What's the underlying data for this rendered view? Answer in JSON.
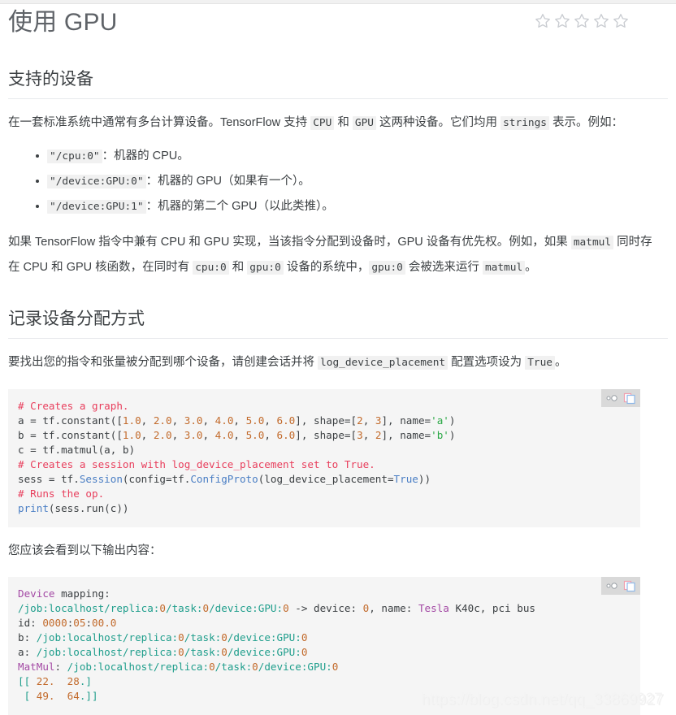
{
  "page": {
    "title": "使用 GPU",
    "watermark": "https://blog.csdn.net/qq_33869927",
    "watermark_shadow": "https://blog.csdn.net/qq_33869927"
  },
  "rating": {
    "name": "star-rating",
    "total": 5,
    "filled": 0
  },
  "sections": [
    {
      "heading": "支持的设备",
      "intro_a": "在一套标准系统中通常有多台计算设备。TensorFlow 支持 ",
      "intro_code1": "CPU",
      "intro_b": " 和 ",
      "intro_code2": "GPU",
      "intro_c": " 这两种设备。它们均用 ",
      "intro_code3": "strings",
      "intro_d": " 表示。例如：",
      "items": [
        {
          "code": "\"/cpu:0\"",
          "text": "：机器的 CPU。"
        },
        {
          "code": "\"/device:GPU:0\"",
          "text": "：机器的 GPU（如果有一个）。"
        },
        {
          "code": "\"/device:GPU:1\"",
          "text": "：机器的第二个 GPU（以此类推）。"
        }
      ],
      "para2_a": "如果 TensorFlow 指令中兼有 CPU 和 GPU 实现，当该指令分配到设备时，GPU 设备有优先权。例如，如果 ",
      "para2_code1": "matmul",
      "para2_b": " 同时存在 CPU 和 GPU 核函数，在同时有 ",
      "para2_code2": "cpu:0",
      "para2_c": " 和 ",
      "para2_code3": "gpu:0",
      "para2_d": " 设备的系统中，",
      "para2_code4": "gpu:0",
      "para2_e": " 会被选来运行 ",
      "para2_code5": "matmul",
      "para2_f": "。"
    },
    {
      "heading": "记录设备分配方式",
      "para_a": "要找出您的指令和张量被分配到哪个设备，请创建会话并将 ",
      "para_code1": "log_device_placement",
      "para_b": " 配置选项设为 ",
      "para_code2": "True",
      "para_c": "。",
      "output_label": "您应该会看到以下输出内容："
    }
  ],
  "code_toolbar": {
    "toggle_icon": "code-collapse-icon",
    "copy_icon": "copy-icon"
  },
  "code_block_python": {
    "lines": [
      [
        {
          "t": "# Creates a graph.",
          "c": "tok-com"
        }
      ],
      [
        {
          "t": "a = tf.constant([",
          "c": "tok-plain"
        },
        {
          "t": "1.0",
          "c": "tok-num"
        },
        {
          "t": ", ",
          "c": "tok-plain"
        },
        {
          "t": "2.0",
          "c": "tok-num"
        },
        {
          "t": ", ",
          "c": "tok-plain"
        },
        {
          "t": "3.0",
          "c": "tok-num"
        },
        {
          "t": ", ",
          "c": "tok-plain"
        },
        {
          "t": "4.0",
          "c": "tok-num"
        },
        {
          "t": ", ",
          "c": "tok-plain"
        },
        {
          "t": "5.0",
          "c": "tok-num"
        },
        {
          "t": ", ",
          "c": "tok-plain"
        },
        {
          "t": "6.0",
          "c": "tok-num"
        },
        {
          "t": "], shape=[",
          "c": "tok-plain"
        },
        {
          "t": "2",
          "c": "tok-num"
        },
        {
          "t": ", ",
          "c": "tok-plain"
        },
        {
          "t": "3",
          "c": "tok-num"
        },
        {
          "t": "], name=",
          "c": "tok-plain"
        },
        {
          "t": "'a'",
          "c": "tok-str"
        },
        {
          "t": ")",
          "c": "tok-plain"
        }
      ],
      [
        {
          "t": "b = tf.constant([",
          "c": "tok-plain"
        },
        {
          "t": "1.0",
          "c": "tok-num"
        },
        {
          "t": ", ",
          "c": "tok-plain"
        },
        {
          "t": "2.0",
          "c": "tok-num"
        },
        {
          "t": ", ",
          "c": "tok-plain"
        },
        {
          "t": "3.0",
          "c": "tok-num"
        },
        {
          "t": ", ",
          "c": "tok-plain"
        },
        {
          "t": "4.0",
          "c": "tok-num"
        },
        {
          "t": ", ",
          "c": "tok-plain"
        },
        {
          "t": "5.0",
          "c": "tok-num"
        },
        {
          "t": ", ",
          "c": "tok-plain"
        },
        {
          "t": "6.0",
          "c": "tok-num"
        },
        {
          "t": "], shape=[",
          "c": "tok-plain"
        },
        {
          "t": "3",
          "c": "tok-num"
        },
        {
          "t": ", ",
          "c": "tok-plain"
        },
        {
          "t": "2",
          "c": "tok-num"
        },
        {
          "t": "], name=",
          "c": "tok-plain"
        },
        {
          "t": "'b'",
          "c": "tok-str"
        },
        {
          "t": ")",
          "c": "tok-plain"
        }
      ],
      [
        {
          "t": "c = tf.matmul(a, b)",
          "c": "tok-plain"
        }
      ],
      [
        {
          "t": "# Creates a session with log_device_placement set to True.",
          "c": "tok-com"
        }
      ],
      [
        {
          "t": "sess = tf.",
          "c": "tok-plain"
        },
        {
          "t": "Session",
          "c": "tok-fn"
        },
        {
          "t": "(config=tf.",
          "c": "tok-plain"
        },
        {
          "t": "ConfigProto",
          "c": "tok-fn"
        },
        {
          "t": "(log_device_placement=",
          "c": "tok-plain"
        },
        {
          "t": "True",
          "c": "tok-kw"
        },
        {
          "t": "))",
          "c": "tok-plain"
        }
      ],
      [
        {
          "t": "# Runs the op.",
          "c": "tok-com"
        }
      ],
      [
        {
          "t": "print",
          "c": "tok-fn"
        },
        {
          "t": "(sess.run(c))",
          "c": "tok-plain"
        }
      ]
    ]
  },
  "code_block_output": {
    "lines": [
      [
        {
          "t": "Device",
          "c": "out-key"
        },
        {
          "t": " mapping:",
          "c": "out-plain"
        }
      ],
      [
        {
          "t": "/job:localhost/replica:",
          "c": "out-path"
        },
        {
          "t": "0",
          "c": "out-num"
        },
        {
          "t": "/task:",
          "c": "out-path"
        },
        {
          "t": "0",
          "c": "out-num"
        },
        {
          "t": "/device:GPU:",
          "c": "out-path"
        },
        {
          "t": "0",
          "c": "out-num"
        },
        {
          "t": " -> device: ",
          "c": "out-plain"
        },
        {
          "t": "0",
          "c": "out-num"
        },
        {
          "t": ", name: ",
          "c": "out-plain"
        },
        {
          "t": "Tesla",
          "c": "out-key"
        },
        {
          "t": " K40c, pci bus",
          "c": "out-plain"
        }
      ],
      [
        {
          "t": "id: ",
          "c": "out-plain"
        },
        {
          "t": "0000",
          "c": "out-num"
        },
        {
          "t": ":",
          "c": "out-plain"
        },
        {
          "t": "05",
          "c": "out-num"
        },
        {
          "t": ":",
          "c": "out-plain"
        },
        {
          "t": "00.0",
          "c": "out-num"
        }
      ],
      [
        {
          "t": "b: ",
          "c": "out-plain"
        },
        {
          "t": "/job:localhost/replica:",
          "c": "out-path"
        },
        {
          "t": "0",
          "c": "out-num"
        },
        {
          "t": "/task:",
          "c": "out-path"
        },
        {
          "t": "0",
          "c": "out-num"
        },
        {
          "t": "/device:GPU:",
          "c": "out-path"
        },
        {
          "t": "0",
          "c": "out-num"
        }
      ],
      [
        {
          "t": "a: ",
          "c": "out-plain"
        },
        {
          "t": "/job:localhost/replica:",
          "c": "out-path"
        },
        {
          "t": "0",
          "c": "out-num"
        },
        {
          "t": "/task:",
          "c": "out-path"
        },
        {
          "t": "0",
          "c": "out-num"
        },
        {
          "t": "/device:GPU:",
          "c": "out-path"
        },
        {
          "t": "0",
          "c": "out-num"
        }
      ],
      [
        {
          "t": "MatMul",
          "c": "out-key"
        },
        {
          "t": ": ",
          "c": "out-plain"
        },
        {
          "t": "/job:localhost/replica:",
          "c": "out-path"
        },
        {
          "t": "0",
          "c": "out-num"
        },
        {
          "t": "/task:",
          "c": "out-path"
        },
        {
          "t": "0",
          "c": "out-num"
        },
        {
          "t": "/device:GPU:",
          "c": "out-path"
        },
        {
          "t": "0",
          "c": "out-num"
        }
      ],
      [
        {
          "t": "[[ ",
          "c": "out-path"
        },
        {
          "t": "22",
          "c": "out-num"
        },
        {
          "t": ".  ",
          "c": "out-num"
        },
        {
          "t": "28",
          "c": "out-num"
        },
        {
          "t": ".]",
          "c": "out-path"
        }
      ],
      [
        {
          "t": " [ ",
          "c": "out-path"
        },
        {
          "t": "49",
          "c": "out-num"
        },
        {
          "t": ".  ",
          "c": "out-num"
        },
        {
          "t": "64",
          "c": "out-num"
        },
        {
          "t": ".]]",
          "c": "out-path"
        }
      ]
    ]
  }
}
